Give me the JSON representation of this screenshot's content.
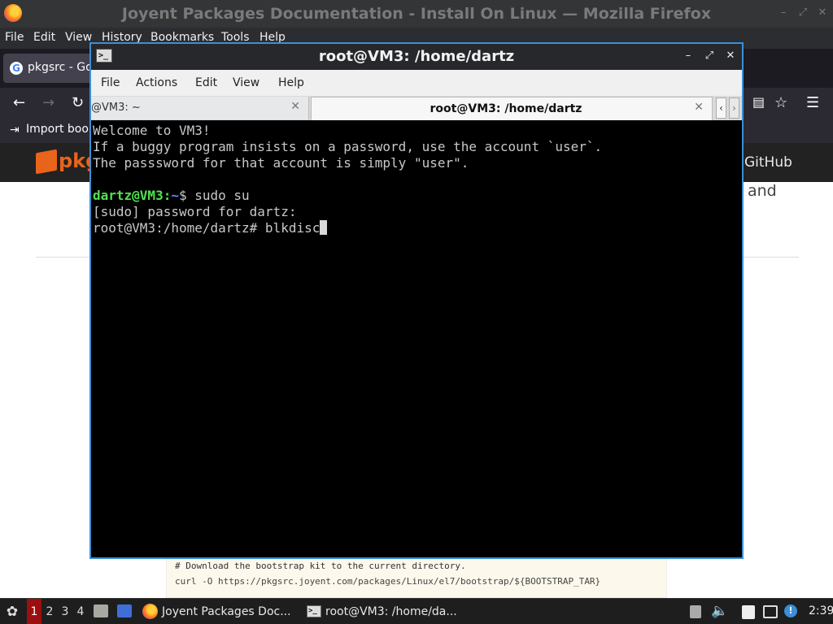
{
  "firefox": {
    "window_title": "Joyent Packages Documentation - Install On Linux — Mozilla Firefox",
    "menu": [
      "File",
      "Edit",
      "View",
      "History",
      "Bookmarks",
      "Tools",
      "Help"
    ],
    "tab_label": "pkgsrc - Goo",
    "bookmarks_label": "Import book",
    "site": {
      "logo_text": "pkg",
      "github_label": "GitHub",
      "text_fragment": "and",
      "code_line1": "# Download the bootstrap kit to the current directory.",
      "code_line2": "curl -O https://pkgsrc.joyent.com/packages/Linux/el7/bootstrap/${BOOTSTRAP_TAR}"
    }
  },
  "terminal": {
    "window_title": "root@VM3: /home/dartz",
    "menu": [
      "File",
      "Actions",
      "Edit",
      "View",
      "Help"
    ],
    "tabs": [
      {
        "label": "@VM3: ~",
        "active": false
      },
      {
        "label": "root@VM3: /home/dartz",
        "active": true
      }
    ],
    "lines": {
      "l1": "Welcome to VM3!",
      "l2": "If a buggy program insists on a password, use the account `user`.",
      "l3": "The passsword for that account is simply \"user\".",
      "prompt_user": "dartz@VM3",
      "prompt_sep": ":",
      "prompt_path": "~",
      "prompt_cmd": "$ sudo su",
      "l5": "[sudo] password for dartz:",
      "l6": "root@VM3:/home/dartz# blkdisc"
    }
  },
  "panel": {
    "workspaces": [
      "1",
      "2",
      "3",
      "4"
    ],
    "active_workspace": "1",
    "tasks": [
      {
        "label": "Joyent Packages Doc...",
        "icon": "firefox-icon"
      },
      {
        "label": "root@VM3: /home/da...",
        "icon": "terminal-icon"
      }
    ],
    "clock": "2:39"
  }
}
